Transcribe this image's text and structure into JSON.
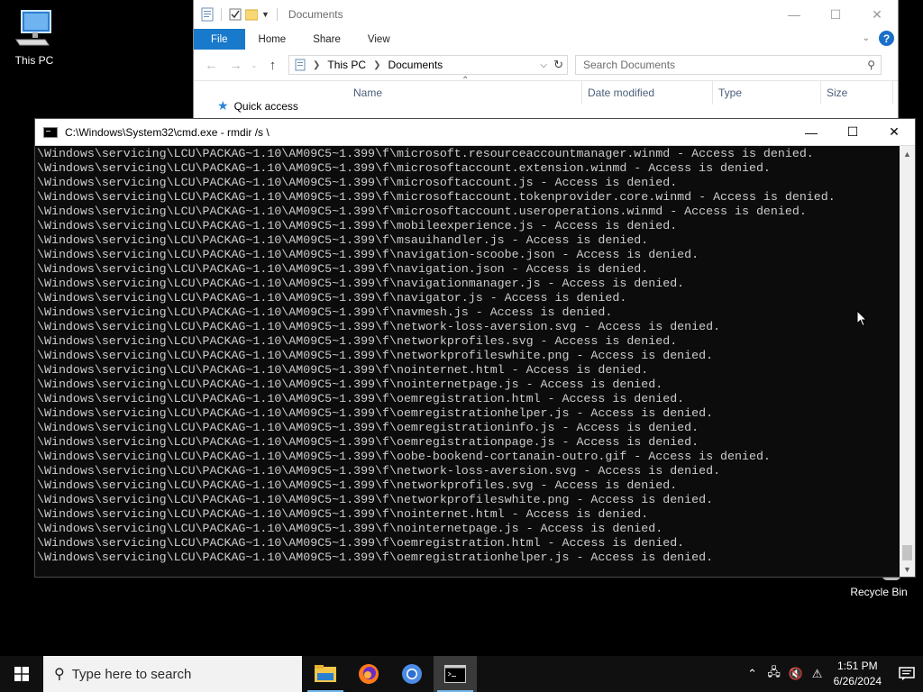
{
  "desktop": {
    "icons": [
      {
        "label": "This PC",
        "icon": "this-pc-icon"
      },
      {
        "label": "Recycle Bin",
        "icon": "recycle-bin-icon"
      }
    ]
  },
  "explorer": {
    "title": "Documents",
    "ribbon_tabs": [
      "File",
      "Home",
      "Share",
      "View"
    ],
    "address": {
      "root": "This PC",
      "current": "Documents"
    },
    "search_placeholder": "Search Documents",
    "columns": [
      "Name",
      "Date modified",
      "Type",
      "Size"
    ],
    "nav_item": "Quick access"
  },
  "cmd": {
    "title": "C:\\Windows\\System32\\cmd.exe - rmdir  /s \\",
    "lines": [
      "\\Windows\\servicing\\LCU\\PACKAG~1.10\\AM09C5~1.399\\f\\microsoft.resourceaccountmanager.winmd - Access is denied.",
      "\\Windows\\servicing\\LCU\\PACKAG~1.10\\AM09C5~1.399\\f\\microsoftaccount.extension.winmd - Access is denied.",
      "\\Windows\\servicing\\LCU\\PACKAG~1.10\\AM09C5~1.399\\f\\microsoftaccount.js - Access is denied.",
      "\\Windows\\servicing\\LCU\\PACKAG~1.10\\AM09C5~1.399\\f\\microsoftaccount.tokenprovider.core.winmd - Access is denied.",
      "\\Windows\\servicing\\LCU\\PACKAG~1.10\\AM09C5~1.399\\f\\microsoftaccount.useroperations.winmd - Access is denied.",
      "\\Windows\\servicing\\LCU\\PACKAG~1.10\\AM09C5~1.399\\f\\mobileexperience.js - Access is denied.",
      "\\Windows\\servicing\\LCU\\PACKAG~1.10\\AM09C5~1.399\\f\\msauihandler.js - Access is denied.",
      "\\Windows\\servicing\\LCU\\PACKAG~1.10\\AM09C5~1.399\\f\\navigation-scoobe.json - Access is denied.",
      "\\Windows\\servicing\\LCU\\PACKAG~1.10\\AM09C5~1.399\\f\\navigation.json - Access is denied.",
      "\\Windows\\servicing\\LCU\\PACKAG~1.10\\AM09C5~1.399\\f\\navigationmanager.js - Access is denied.",
      "\\Windows\\servicing\\LCU\\PACKAG~1.10\\AM09C5~1.399\\f\\navigator.js - Access is denied.",
      "\\Windows\\servicing\\LCU\\PACKAG~1.10\\AM09C5~1.399\\f\\navmesh.js - Access is denied.",
      "\\Windows\\servicing\\LCU\\PACKAG~1.10\\AM09C5~1.399\\f\\network-loss-aversion.svg - Access is denied.",
      "\\Windows\\servicing\\LCU\\PACKAG~1.10\\AM09C5~1.399\\f\\networkprofiles.svg - Access is denied.",
      "\\Windows\\servicing\\LCU\\PACKAG~1.10\\AM09C5~1.399\\f\\networkprofileswhite.png - Access is denied.",
      "\\Windows\\servicing\\LCU\\PACKAG~1.10\\AM09C5~1.399\\f\\nointernet.html - Access is denied.",
      "\\Windows\\servicing\\LCU\\PACKAG~1.10\\AM09C5~1.399\\f\\nointernetpage.js - Access is denied.",
      "\\Windows\\servicing\\LCU\\PACKAG~1.10\\AM09C5~1.399\\f\\oemregistration.html - Access is denied.",
      "\\Windows\\servicing\\LCU\\PACKAG~1.10\\AM09C5~1.399\\f\\oemregistrationhelper.js - Access is denied.",
      "\\Windows\\servicing\\LCU\\PACKAG~1.10\\AM09C5~1.399\\f\\oemregistrationinfo.js - Access is denied.",
      "\\Windows\\servicing\\LCU\\PACKAG~1.10\\AM09C5~1.399\\f\\oemregistrationpage.js - Access is denied.",
      "\\Windows\\servicing\\LCU\\PACKAG~1.10\\AM09C5~1.399\\f\\oobe-bookend-cortanain-outro.gif - Access is denied.",
      "\\Windows\\servicing\\LCU\\PACKAG~1.10\\AM09C5~1.399\\f\\network-loss-aversion.svg - Access is denied.",
      "\\Windows\\servicing\\LCU\\PACKAG~1.10\\AM09C5~1.399\\f\\networkprofiles.svg - Access is denied.",
      "\\Windows\\servicing\\LCU\\PACKAG~1.10\\AM09C5~1.399\\f\\networkprofileswhite.png - Access is denied.",
      "\\Windows\\servicing\\LCU\\PACKAG~1.10\\AM09C5~1.399\\f\\nointernet.html - Access is denied.",
      "\\Windows\\servicing\\LCU\\PACKAG~1.10\\AM09C5~1.399\\f\\nointernetpage.js - Access is denied.",
      "\\Windows\\servicing\\LCU\\PACKAG~1.10\\AM09C5~1.399\\f\\oemregistration.html - Access is denied.",
      "\\Windows\\servicing\\LCU\\PACKAG~1.10\\AM09C5~1.399\\f\\oemregistrationhelper.js - Access is denied."
    ]
  },
  "taskbar": {
    "search_placeholder": "Type here to search",
    "apps": [
      "file-explorer-icon",
      "firefox-icon",
      "chromium-icon",
      "cmd-icon"
    ],
    "clock": {
      "time": "1:51 PM",
      "date": "6/26/2024"
    }
  },
  "colors": {
    "accent": "#1979ca",
    "console_bg": "#0c0c0c",
    "console_text": "#cccccc",
    "taskbar": "#101010"
  }
}
